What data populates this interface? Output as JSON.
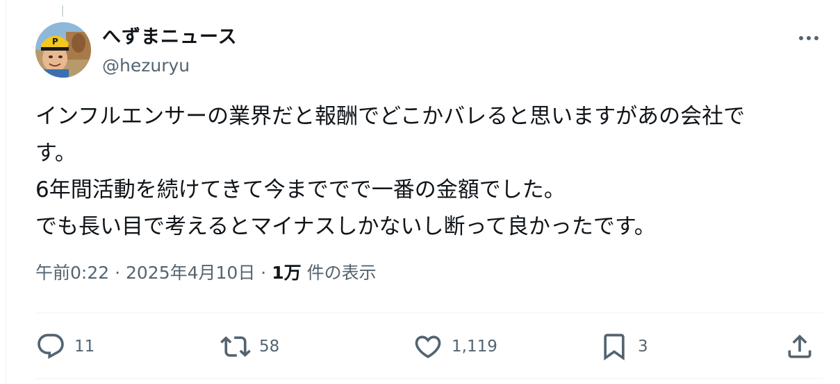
{
  "author": {
    "display_name": "へずまニュース",
    "handle": "@hezuryu"
  },
  "tweet": {
    "lines": [
      "インフルエンサーの業界だと報酬でどこかバレると思いますがあの会社で",
      "す。",
      "6年間活動を続けてきて今まででで一番の金額でした。",
      "でも長い目で考えるとマイナスしかないし断って良かったです。"
    ],
    "time": "午前0:22",
    "separator": "·",
    "date": "2025年4月10日",
    "views_count": "1万",
    "views_label": "件の表示"
  },
  "actions": {
    "replies": "11",
    "reposts": "58",
    "likes": "1,119",
    "bookmarks": "3"
  },
  "icons": {
    "more": "more-horizontal-icon",
    "reply": "reply-bubble-icon",
    "repost": "repost-arrows-icon",
    "like": "heart-icon",
    "bookmark": "bookmark-icon",
    "share": "share-upload-icon"
  },
  "colors": {
    "text_primary": "#0f1419",
    "text_secondary": "#536471",
    "divider": "#eff3f4"
  }
}
